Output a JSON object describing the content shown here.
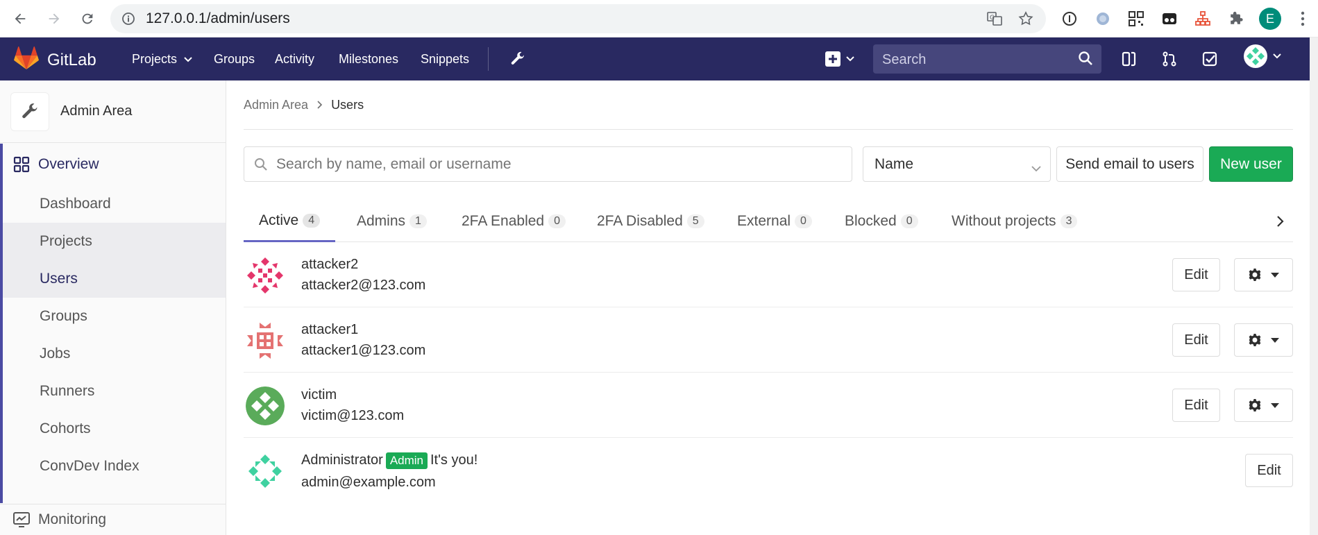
{
  "browser": {
    "url": "127.0.0.1/admin/users",
    "profile_initial": "E",
    "colors": {
      "profile": "#008c7a"
    }
  },
  "navbar": {
    "brand": "GitLab",
    "links": [
      "Projects",
      "Groups",
      "Activity",
      "Milestones",
      "Snippets"
    ],
    "search_placeholder": "Search",
    "colors": {
      "background": "#292961",
      "search": "#46467c"
    }
  },
  "sidebar": {
    "title": "Admin Area",
    "overview_label": "Overview",
    "items": [
      "Dashboard",
      "Projects",
      "Users",
      "Groups",
      "Jobs",
      "Runners",
      "Cohorts",
      "ConvDev Index"
    ],
    "active_item": "Users",
    "monitoring_label": "Monitoring"
  },
  "breadcrumb": {
    "parent": "Admin Area",
    "current": "Users"
  },
  "filters": {
    "search_placeholder": "Search by name, email or username",
    "sort_value": "Name",
    "send_email_label": "Send email to users",
    "new_user_label": "New user",
    "colors": {
      "new_user": "#1aaa55"
    }
  },
  "tabs": [
    {
      "label": "Active",
      "count": "4"
    },
    {
      "label": "Admins",
      "count": "1"
    },
    {
      "label": "2FA Enabled",
      "count": "0"
    },
    {
      "label": "2FA Disabled",
      "count": "5"
    },
    {
      "label": "External",
      "count": "0"
    },
    {
      "label": "Blocked",
      "count": "0"
    },
    {
      "label": "Without projects",
      "count": "3"
    }
  ],
  "users": [
    {
      "name": "attacker2",
      "email": "attacker2@123.com",
      "edit_label": "Edit",
      "avatar_color": "#e4366b"
    },
    {
      "name": "attacker1",
      "email": "attacker1@123.com",
      "edit_label": "Edit",
      "avatar_color": "#e47272"
    },
    {
      "name": "victim",
      "email": "victim@123.com",
      "edit_label": "Edit",
      "avatar_color": "#5aab5a"
    },
    {
      "name": "Administrator",
      "email": "admin@example.com",
      "edit_label": "Edit",
      "avatar_color": "#3fd1a0",
      "badge": "Admin",
      "note": "It's you!"
    }
  ]
}
